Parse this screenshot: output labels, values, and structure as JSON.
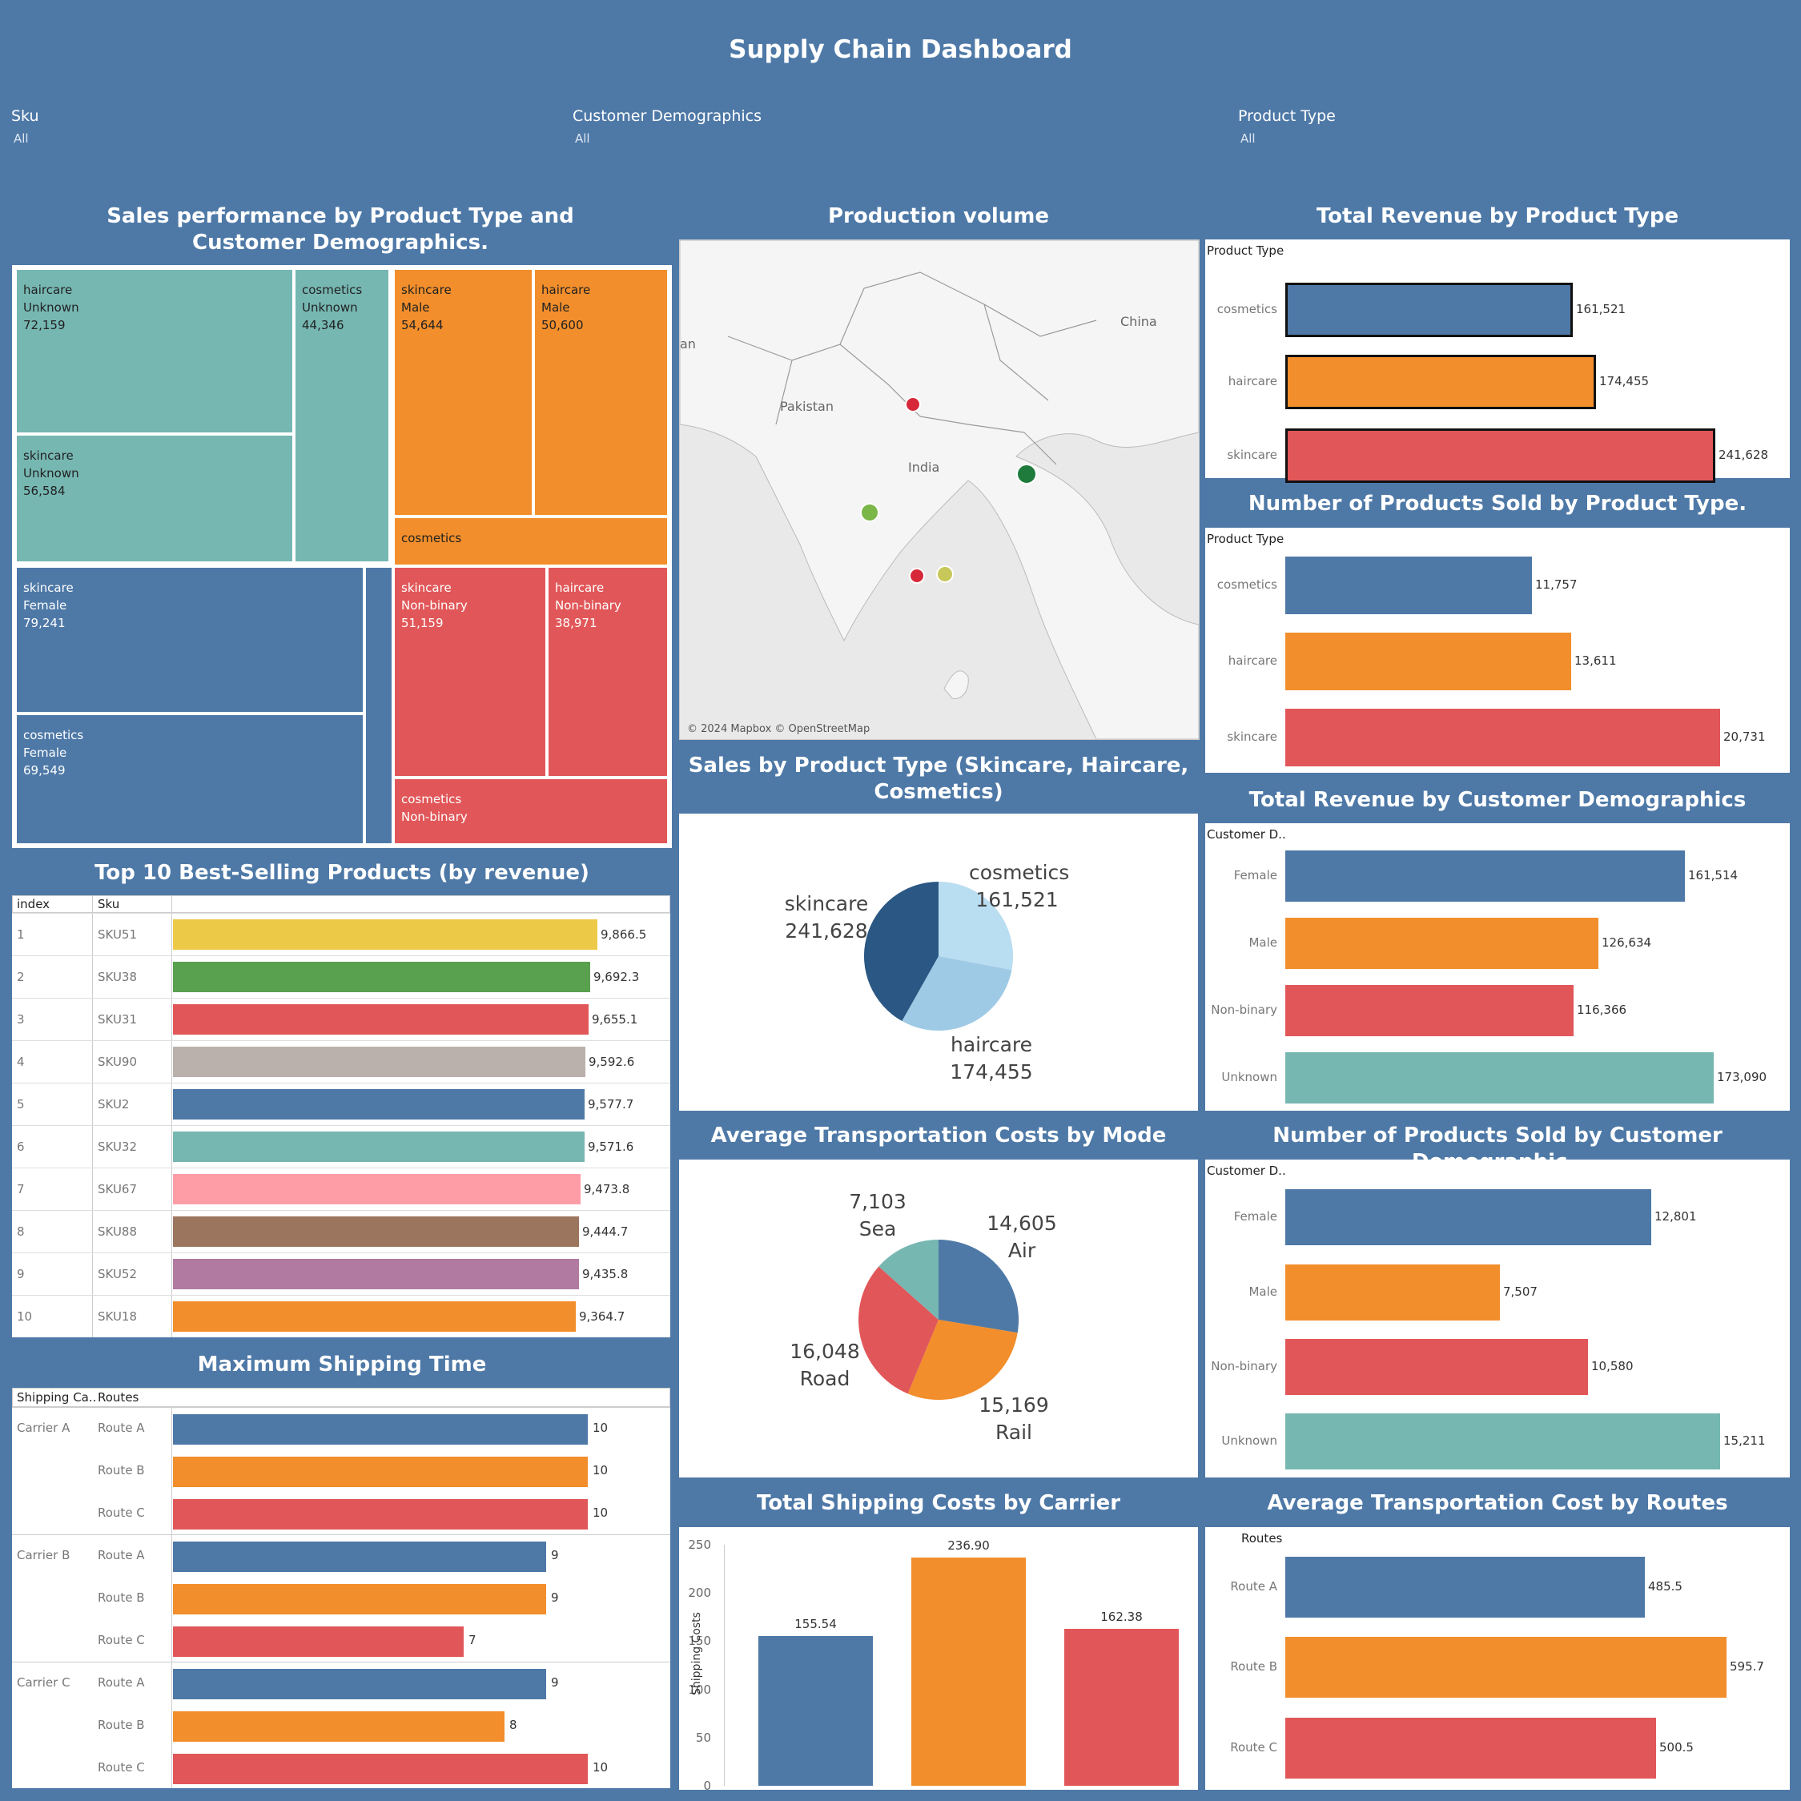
{
  "title": "Supply Chain Dashboard",
  "filters": [
    {
      "label": "Sku",
      "value": "All"
    },
    {
      "label": "Customer Demographics",
      "value": "All"
    },
    {
      "label": "Product Type",
      "value": "All"
    }
  ],
  "treemap": {
    "title": "Sales performance by Product Type and Customer Demographics.",
    "cells": [
      {
        "l1": "haircare",
        "l2": "Unknown",
        "l3": "72,159"
      },
      {
        "l1": "cosmetics",
        "l2": "Unknown",
        "l3": "44,346"
      },
      {
        "l1": "skincare",
        "l2": "Unknown",
        "l3": "56,584"
      },
      {
        "l1": "skincare",
        "l2": "Male",
        "l3": "54,644"
      },
      {
        "l1": "haircare",
        "l2": "Male",
        "l3": "50,600"
      },
      {
        "l1": "cosmetics",
        "l2": "",
        "l3": ""
      },
      {
        "l1": "skincare",
        "l2": "Female",
        "l3": "79,241"
      },
      {
        "l1": "cosmetics",
        "l2": "Female",
        "l3": "69,549"
      },
      {
        "l1": "",
        "l2": "",
        "l3": ""
      },
      {
        "l1": "skincare",
        "l2": "Non-binary",
        "l3": "51,159"
      },
      {
        "l1": "haircare",
        "l2": "Non-binary",
        "l3": "38,971"
      },
      {
        "l1": "cosmetics",
        "l2": "Non-binary",
        "l3": ""
      }
    ]
  },
  "map": {
    "title": "Production volume",
    "labels": {
      "china": "China",
      "pakistan": "Pakistan",
      "india": "India",
      "partial": "an"
    },
    "attribution": "© 2024 Mapbox © OpenStreetMap",
    "colors": {
      "red": "#d62839",
      "green": "#1e7b3c",
      "lightgreen": "#7ab648",
      "yellow": "#c8c85a"
    }
  },
  "top10": {
    "title": "Top 10 Best-Selling Products (by revenue)",
    "headers": {
      "index": "index",
      "sku": "Sku"
    },
    "rows": [
      {
        "index": "1",
        "sku": "SKU51",
        "value": 9866.5,
        "label": "9,866.5",
        "color": "#edc948"
      },
      {
        "index": "2",
        "sku": "SKU38",
        "value": 9692.3,
        "label": "9,692.3",
        "color": "#59a14f"
      },
      {
        "index": "3",
        "sku": "SKU31",
        "value": 9655.1,
        "label": "9,655.1",
        "color": "#e15759"
      },
      {
        "index": "4",
        "sku": "SKU90",
        "value": 9592.6,
        "label": "9,592.6",
        "color": "#bab0ac"
      },
      {
        "index": "5",
        "sku": "SKU2",
        "value": 9577.7,
        "label": "9,577.7",
        "color": "#4e79a7"
      },
      {
        "index": "6",
        "sku": "SKU32",
        "value": 9571.6,
        "label": "9,571.6",
        "color": "#76b7b2"
      },
      {
        "index": "7",
        "sku": "SKU67",
        "value": 9473.8,
        "label": "9,473.8",
        "color": "#ff9da7"
      },
      {
        "index": "8",
        "sku": "SKU88",
        "value": 9444.7,
        "label": "9,444.7",
        "color": "#9c755f"
      },
      {
        "index": "9",
        "sku": "SKU52",
        "value": 9435.8,
        "label": "9,435.8",
        "color": "#b07aa1"
      },
      {
        "index": "10",
        "sku": "SKU18",
        "value": 9364.7,
        "label": "9,364.7",
        "color": "#f28e2b"
      }
    ]
  },
  "shipping_time": {
    "title": "Maximum Shipping Time",
    "headers": {
      "carrier": "Shipping Ca..",
      "routes": "Routes"
    },
    "rows": [
      {
        "carrier": "Carrier A",
        "route": "Route A",
        "value": 10,
        "color": "#4e79a7"
      },
      {
        "carrier": "",
        "route": "Route B",
        "value": 10,
        "color": "#f28e2b"
      },
      {
        "carrier": "",
        "route": "Route C",
        "value": 10,
        "color": "#e15759"
      },
      {
        "carrier": "Carrier B",
        "route": "Route A",
        "value": 9,
        "color": "#4e79a7"
      },
      {
        "carrier": "",
        "route": "Route B",
        "value": 9,
        "color": "#f28e2b"
      },
      {
        "carrier": "",
        "route": "Route C",
        "value": 7,
        "color": "#e15759"
      },
      {
        "carrier": "Carrier C",
        "route": "Route A",
        "value": 9,
        "color": "#4e79a7"
      },
      {
        "carrier": "",
        "route": "Route B",
        "value": 8,
        "color": "#f28e2b"
      },
      {
        "carrier": "",
        "route": "Route C",
        "value": 10,
        "color": "#e15759"
      }
    ]
  },
  "sales_pie": {
    "title": "Sales by Product Type (Skincare, Haircare, Cosmetics)",
    "slices": [
      {
        "name": "cosmetics",
        "value": 161521,
        "label": "161,521",
        "color": "#b9ddf1"
      },
      {
        "name": "haircare",
        "value": 174455,
        "label": "174,455",
        "color": "#9fcae6"
      },
      {
        "name": "skincare",
        "value": 241628,
        "label": "241,628",
        "color": "#2a5783"
      }
    ]
  },
  "transport_pie": {
    "title": "Average Transportation Costs by Mode",
    "slices": [
      {
        "name": "Air",
        "value": 14605,
        "label": "14,605",
        "color": "#4e79a7"
      },
      {
        "name": "Rail",
        "value": 15169,
        "label": "15,169",
        "color": "#f28e2b"
      },
      {
        "name": "Road",
        "value": 16048,
        "label": "16,048",
        "color": "#e15759"
      },
      {
        "name": "Sea",
        "value": 7103,
        "label": "7,103",
        "color": "#76b7b2"
      }
    ]
  },
  "carrier_costs": {
    "title": "Total Shipping Costs by Carrier",
    "ylabel": "Shipping Costs",
    "yticks": [
      "250",
      "200",
      "150",
      "100",
      "50",
      "0"
    ],
    "ymax": 250,
    "bars": [
      {
        "value": 155.54,
        "label": "155.54",
        "color": "#4e79a7"
      },
      {
        "value": 236.9,
        "label": "236.90",
        "color": "#f28e2b"
      },
      {
        "value": 162.38,
        "label": "162.38",
        "color": "#e15759"
      }
    ]
  },
  "revenue_type": {
    "title": "Total Revenue by Product Type",
    "header": "Product Type",
    "max": 241628,
    "rows": [
      {
        "cat": "cosmetics",
        "value": 161521,
        "label": "161,521",
        "color": "#4e79a7"
      },
      {
        "cat": "haircare",
        "value": 174455,
        "label": "174,455",
        "color": "#f28e2b"
      },
      {
        "cat": "skincare",
        "value": 241628,
        "label": "241,628",
        "color": "#e15759"
      }
    ]
  },
  "sold_type": {
    "title": "Number of Products Sold by Product Type.",
    "header": "Product Type",
    "max": 20731,
    "rows": [
      {
        "cat": "cosmetics",
        "value": 11757,
        "label": "11,757",
        "color": "#4e79a7"
      },
      {
        "cat": "haircare",
        "value": 13611,
        "label": "13,611",
        "color": "#f28e2b"
      },
      {
        "cat": "skincare",
        "value": 20731,
        "label": "20,731",
        "color": "#e15759"
      }
    ]
  },
  "revenue_demo": {
    "title": "Total Revenue by Customer Demographics",
    "header": "Customer D..",
    "max": 173090,
    "rows": [
      {
        "cat": "Female",
        "value": 161514,
        "label": "161,514",
        "color": "#4e79a7"
      },
      {
        "cat": "Male",
        "value": 126634,
        "label": "126,634",
        "color": "#f28e2b"
      },
      {
        "cat": "Non-binary",
        "value": 116366,
        "label": "116,366",
        "color": "#e15759"
      },
      {
        "cat": "Unknown",
        "value": 173090,
        "label": "173,090",
        "color": "#76b7b2"
      }
    ]
  },
  "sold_demo": {
    "title": "Number of Products Sold by Customer Demographic..",
    "header": "Customer D..",
    "max": 15211,
    "rows": [
      {
        "cat": "Female",
        "value": 12801,
        "label": "12,801",
        "color": "#4e79a7"
      },
      {
        "cat": "Male",
        "value": 7507,
        "label": "7,507",
        "color": "#f28e2b"
      },
      {
        "cat": "Non-binary",
        "value": 10580,
        "label": "10,580",
        "color": "#e15759"
      },
      {
        "cat": "Unknown",
        "value": 15211,
        "label": "15,211",
        "color": "#76b7b2"
      }
    ]
  },
  "route_cost": {
    "title": "Average Transportation Cost by Routes",
    "header": "Routes",
    "max": 595.7,
    "rows": [
      {
        "cat": "Route A",
        "value": 485.5,
        "label": "485.5",
        "color": "#4e79a7"
      },
      {
        "cat": "Route B",
        "value": 595.7,
        "label": "595.7",
        "color": "#f28e2b"
      },
      {
        "cat": "Route C",
        "value": 500.5,
        "label": "500.5",
        "color": "#e15759"
      }
    ]
  },
  "chart_data": [
    {
      "type": "bar",
      "title": "Top 10 Best-Selling Products (by revenue)",
      "categories": [
        "SKU51",
        "SKU38",
        "SKU31",
        "SKU90",
        "SKU2",
        "SKU32",
        "SKU67",
        "SKU88",
        "SKU52",
        "SKU18"
      ],
      "values": [
        9866.5,
        9692.3,
        9655.1,
        9592.6,
        9577.7,
        9571.6,
        9473.8,
        9444.7,
        9435.8,
        9364.7
      ]
    },
    {
      "type": "bar",
      "title": "Maximum Shipping Time",
      "categories": [
        "Carrier A Route A",
        "Carrier A Route B",
        "Carrier A Route C",
        "Carrier B Route A",
        "Carrier B Route B",
        "Carrier B Route C",
        "Carrier C Route A",
        "Carrier C Route B",
        "Carrier C Route C"
      ],
      "values": [
        10,
        10,
        10,
        9,
        9,
        7,
        9,
        8,
        10
      ]
    },
    {
      "type": "pie",
      "title": "Sales by Product Type (Skincare, Haircare, Cosmetics)",
      "categories": [
        "cosmetics",
        "haircare",
        "skincare"
      ],
      "values": [
        161521,
        174455,
        241628
      ]
    },
    {
      "type": "pie",
      "title": "Average Transportation Costs by Mode",
      "categories": [
        "Air",
        "Rail",
        "Road",
        "Sea"
      ],
      "values": [
        14605,
        15169,
        16048,
        7103
      ]
    },
    {
      "type": "bar",
      "title": "Total Shipping Costs by Carrier",
      "ylabel": "Shipping Costs",
      "values": [
        155.54,
        236.9,
        162.38
      ],
      "ylim": [
        0,
        250
      ]
    },
    {
      "type": "bar",
      "title": "Total Revenue by Product Type",
      "categories": [
        "cosmetics",
        "haircare",
        "skincare"
      ],
      "values": [
        161521,
        174455,
        241628
      ]
    },
    {
      "type": "bar",
      "title": "Number of Products Sold by Product Type.",
      "categories": [
        "cosmetics",
        "haircare",
        "skincare"
      ],
      "values": [
        11757,
        13611,
        20731
      ]
    },
    {
      "type": "bar",
      "title": "Total Revenue by Customer Demographics",
      "categories": [
        "Female",
        "Male",
        "Non-binary",
        "Unknown"
      ],
      "values": [
        161514,
        126634,
        116366,
        173090
      ]
    },
    {
      "type": "bar",
      "title": "Number of Products Sold by Customer Demographic..",
      "categories": [
        "Female",
        "Male",
        "Non-binary",
        "Unknown"
      ],
      "values": [
        12801,
        7507,
        10580,
        15211
      ]
    },
    {
      "type": "bar",
      "title": "Average Transportation Cost by Routes",
      "categories": [
        "Route A",
        "Route B",
        "Route C"
      ],
      "values": [
        485.5,
        595.7,
        500.5
      ]
    }
  ]
}
